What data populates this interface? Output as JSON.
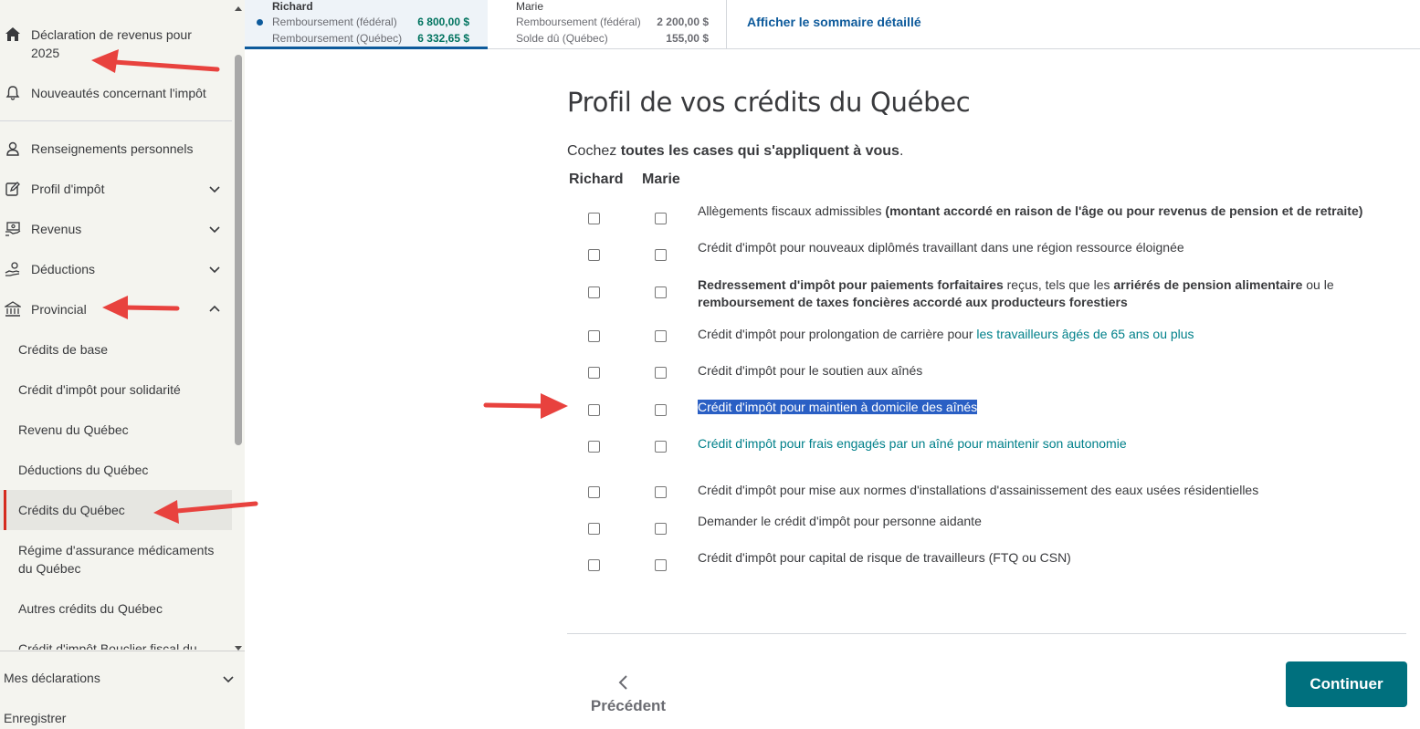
{
  "sidebar": {
    "items": {
      "home": "Déclaration de revenus pour 2025",
      "news": "Nouveautés concernant l'impôt",
      "personal": "Renseignements personnels",
      "tax_profile": "Profil d'impôt",
      "income": "Revenus",
      "deductions": "Déductions",
      "provincial": "Provincial"
    },
    "sub_items": [
      "Crédits de base",
      "Crédit d'impôt pour solidarité",
      "Revenu du Québec",
      "Déductions du Québec",
      "Crédits du Québec",
      "Régime d'assurance médicaments du Québec",
      "Autres crédits du Québec",
      "Crédit d'impôt Bouclier fiscal du"
    ],
    "active_sub_item": "Crédits du Québec",
    "bottom": {
      "returns": "Mes déclarations",
      "save": "Enregistrer"
    }
  },
  "summary": {
    "person1": {
      "name": "Richard",
      "line1_label": "Remboursement (fédéral)",
      "line1_amount": "6 800,00 $",
      "line2_label": "Remboursement (Québec)",
      "line2_amount": "6 332,65 $"
    },
    "person2": {
      "name": "Marie",
      "line1_label": "Remboursement (fédéral)",
      "line1_amount": "2 200,00 $",
      "line2_label": "Solde dû (Québec)",
      "line2_amount": "155,00 $"
    },
    "detail_link": "Afficher le sommaire détaillé"
  },
  "main": {
    "title": "Profil de vos crédits du Québec",
    "instruction_prefix": "Cochez ",
    "instruction_bold": "toutes les cases qui s'appliquent à vous",
    "instruction_suffix": ".",
    "col1": "Richard",
    "col2": "Marie",
    "items": {
      "i1_a": "Allègements fiscaux admissibles ",
      "i1_b": "(montant accordé en raison de l'âge ou pour revenus de pension et de retraite)",
      "i2": "Crédit d'impôt pour nouveaux diplômés travaillant dans une région ressource éloignée",
      "i3_a": "Redressement d'impôt pour paiements forfaitaires",
      "i3_b": " reçus, tels que les ",
      "i3_c": "arriérés de pension alimentaire",
      "i3_d": " ou le ",
      "i3_e": "remboursement de taxes foncières accordé aux producteurs forestiers",
      "i4_a": "Crédit d'impôt pour prolongation de carrière pour ",
      "i4_b": "les travailleurs âgés de 65 ans ou plus",
      "i5": "Crédit d'impôt pour le soutien aux aînés",
      "i6": "Crédit d'impôt pour maintien à domicile des aînés",
      "i7": "Crédit d'impôt pour frais engagés par un aîné pour maintenir son autonomie",
      "i8": "Crédit d'impôt pour mise aux normes d'installations d'assainissement des eaux usées résidentielles",
      "i9": "Demander le crédit d'impôt pour personne aidante",
      "i10": "Crédit d'impôt pour capital de risque de travailleurs (FTQ ou CSN)"
    },
    "previous": "Précédent",
    "continue": "Continuer"
  },
  "colors": {
    "accent_blue": "#0d5a9b",
    "teal_link": "#00808a",
    "continue_bg": "#00707e",
    "annotation_arrow": "#e8423e",
    "selection": "#2a5fc4"
  }
}
